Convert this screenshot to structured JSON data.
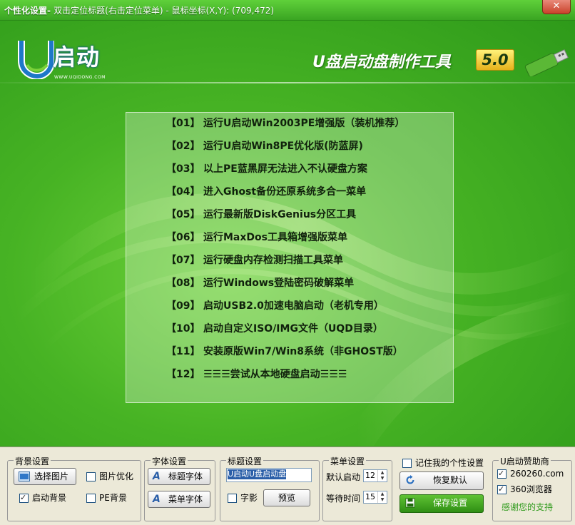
{
  "titlebar": {
    "title": "个性化设置-",
    "subtitle": "双击定位标题(右击定位菜单) - 鼠标坐标(X,Y): (709,472)",
    "close": "✕"
  },
  "logo": {
    "text": "启动",
    "url": "WWW.UQIDONG.COM"
  },
  "header": {
    "app_title": "U盘启动盘制作工具",
    "version": "5.0"
  },
  "menu_items": [
    {
      "num": "【01】",
      "label": "运行U启动Win2003PE增强版（装机推荐）"
    },
    {
      "num": "【02】",
      "label": "运行U启动Win8PE优化版(防蓝屏)"
    },
    {
      "num": "【03】",
      "label": "以上PE蓝黑屏无法进入不认硬盘方案"
    },
    {
      "num": "【04】",
      "label": "进入Ghost备份还原系统多合一菜单"
    },
    {
      "num": "【05】",
      "label": "运行最新版DiskGenius分区工具"
    },
    {
      "num": "【06】",
      "label": "运行MaxDos工具箱增强版菜单"
    },
    {
      "num": "【07】",
      "label": "运行硬盘内存检测扫描工具菜单"
    },
    {
      "num": "【08】",
      "label": "运行Windows登陆密码破解菜单"
    },
    {
      "num": "【09】",
      "label": "启动USB2.0加速电脑启动（老机专用）"
    },
    {
      "num": "【10】",
      "label": "启动自定义ISO/IMG文件（UQD目录）"
    },
    {
      "num": "【11】",
      "label": "安装原版Win7/Win8系统（非GHOST版）"
    },
    {
      "num": "【12】",
      "label": "☰☰☰尝试从本地硬盘启动☰☰☰"
    }
  ],
  "toolbar": {
    "background": {
      "title": "背景设置",
      "choose_image": "选择图片",
      "optimize_image": "图片优化",
      "boot_background": "启动背景",
      "pe_background": "PE背景"
    },
    "font": {
      "title": "字体设置",
      "title_font": "标题字体",
      "menu_font": "菜单字体"
    },
    "title_settings": {
      "title": "标题设置",
      "input_value": "U启动U盘启动盘",
      "shadow": "字影",
      "preview": "预览"
    },
    "menu_settings": {
      "title": "菜单设置",
      "default_boot": "默认启动",
      "default_boot_value": "12",
      "wait_time": "等待时间",
      "wait_time_value": "15"
    },
    "remember": "记住我的个性设置",
    "restore_default": "恢复默认",
    "save": "保存设置",
    "sponsor": {
      "title": "U启动赞助商",
      "item1": "260260.com",
      "item2": "360浏览器",
      "thanks": "感谢您的支持"
    }
  },
  "colors": {
    "accent_green": "#2f9a1c",
    "save_button": "#3fa61c"
  }
}
